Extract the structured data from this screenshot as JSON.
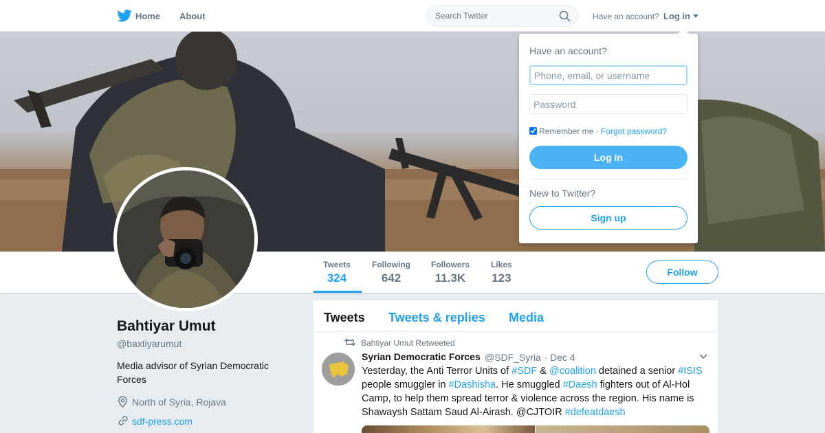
{
  "nav": {
    "home": "Home",
    "about": "About",
    "search_placeholder": "Search Twitter",
    "have_account": "Have an account?",
    "login": "Log in"
  },
  "profile": {
    "name": "Bahtiyar Umut",
    "handle": "@baxtiyarumut",
    "bio": "Media advisor of Syrian Democratic Forces",
    "location": "North of Syria, Rojava",
    "website": "sdf-press.com",
    "follow_label": "Follow",
    "stats": [
      {
        "label": "Tweets",
        "value": "324"
      },
      {
        "label": "Following",
        "value": "642"
      },
      {
        "label": "Followers",
        "value": "11.3K"
      },
      {
        "label": "Likes",
        "value": "123"
      }
    ]
  },
  "timeline": {
    "tabs": [
      "Tweets",
      "Tweets & replies",
      "Media"
    ],
    "tweet": {
      "retweeted_by": "Bahtiyar Umut Retweeted",
      "author_name": "Syrian Democratic Forces",
      "author_handle": "@SDF_Syria",
      "separator": "·",
      "date": "Dec 4",
      "text_parts": [
        {
          "t": "Yesterday, the Anti Terror Units of ",
          "hl": false
        },
        {
          "t": "#SDF",
          "hl": true
        },
        {
          "t": " & ",
          "hl": false
        },
        {
          "t": "@coalition",
          "hl": true
        },
        {
          "t": " detained a senior ",
          "hl": false
        },
        {
          "t": "#ISIS",
          "hl": true
        },
        {
          "t": " people smuggler in ",
          "hl": false
        },
        {
          "t": "#Dashisha",
          "hl": true
        },
        {
          "t": ". He smuggled ",
          "hl": false
        },
        {
          "t": "#Daesh",
          "hl": true
        },
        {
          "t": " fighters out of Al-Hol Camp, to help them spread terror & violence across the region. His name is Shawaysh Sattam Saud Al-Airash. @CJTOIR ",
          "hl": false
        },
        {
          "t": "#defeatdaesh",
          "hl": true
        }
      ]
    }
  },
  "login_popup": {
    "title": "Have an account?",
    "username_placeholder": "Phone, email, or username",
    "password_placeholder": "Password",
    "remember": "Remember me",
    "dot": " · ",
    "forgot": "Forgot password?",
    "login_button": "Log in",
    "new_to": "New to Twitter?",
    "signup_button": "Sign up"
  },
  "colors": {
    "accent": "#1da1f2",
    "login_button": "#4ab3f4",
    "background": "#e6ecf0"
  }
}
